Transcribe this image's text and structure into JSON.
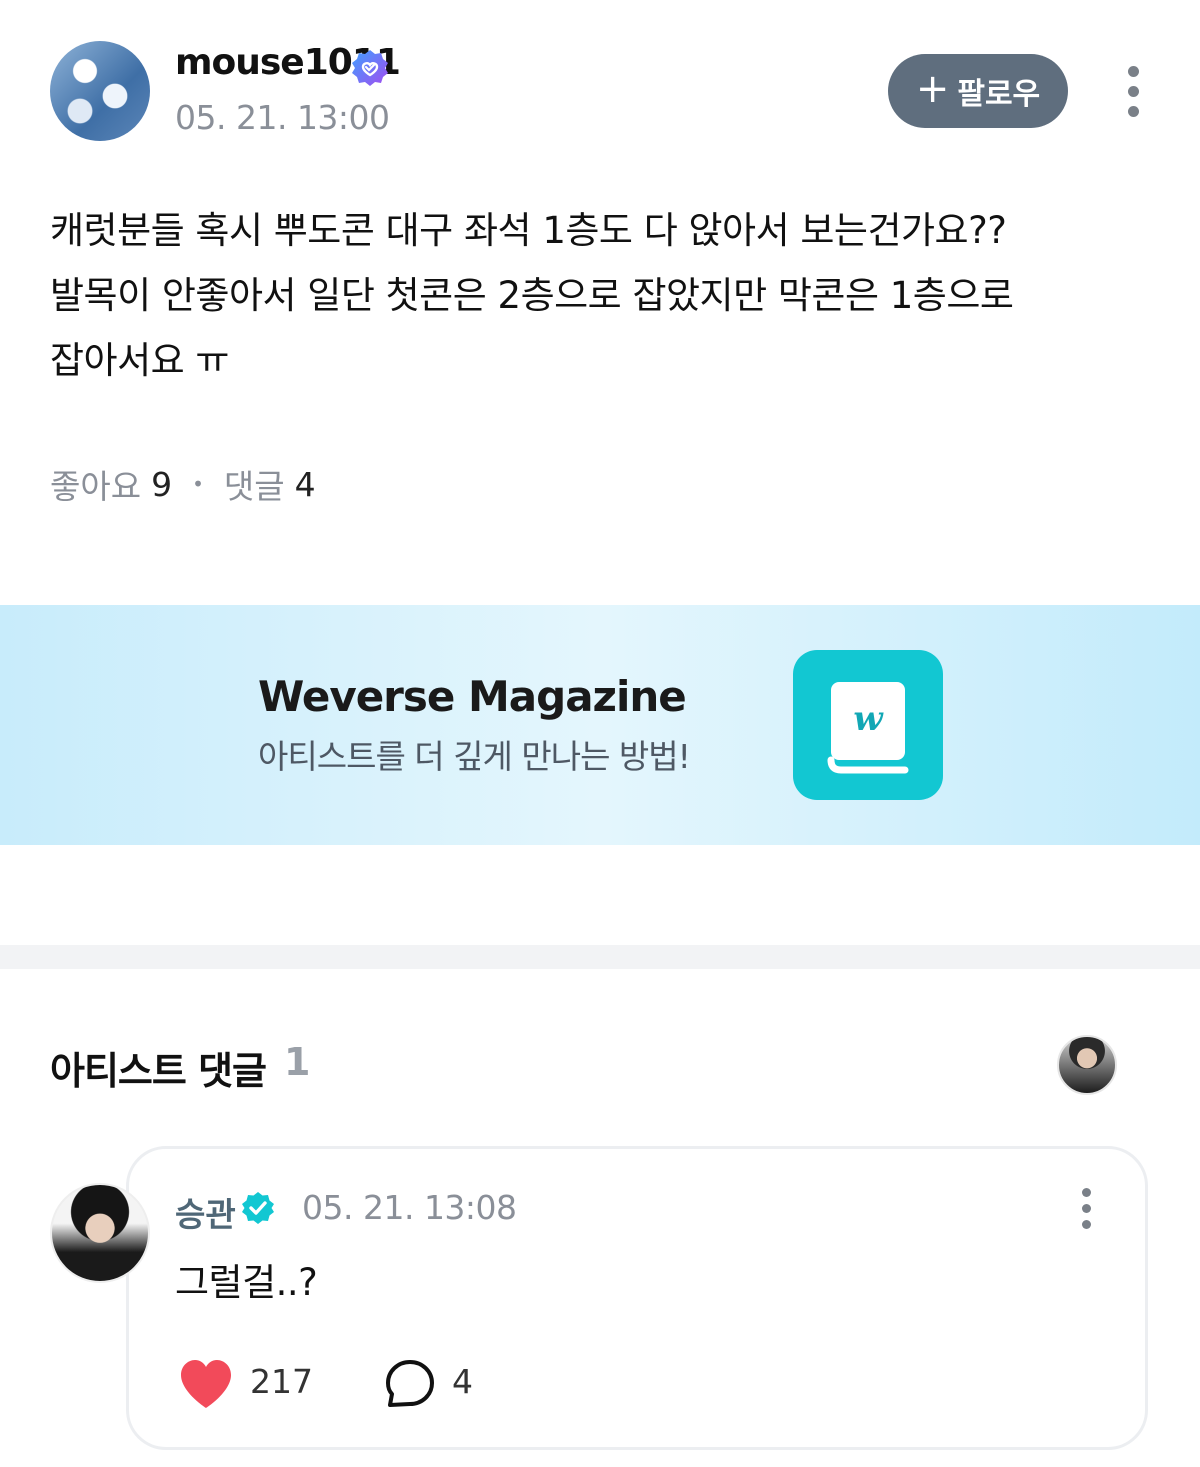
{
  "post": {
    "username": "mouse1011",
    "timestamp": "05. 21. 13:00",
    "follow_label": "팔로우",
    "body": "캐럿분들 혹시 뿌도콘 대구 좌석 1층도 다 앉아서 보는건가요??\n발목이 안좋아서 일단 첫콘은 2층으로 잡았지만 막콘은 1층으로\n잡아서요 ㅠ",
    "likes_label": "좋아요",
    "likes_count": "9",
    "comments_label": "댓글",
    "comments_count": "4"
  },
  "banner": {
    "title": "Weverse Magazine",
    "subtitle": "아티스트를 더 깊게 만나는 방법!",
    "icon_color": "#12c7d2"
  },
  "artist_comments": {
    "title": "아티스트 댓글",
    "count": "1",
    "comment": {
      "name": "승관",
      "timestamp": "05. 21. 13:08",
      "text": "그럴걸..?",
      "likes": "217",
      "replies": "4"
    }
  },
  "colors": {
    "follow_bg": "#5f6e7e",
    "verified_purple": "#7b5cf0",
    "verified_teal": "#12c7d2",
    "heart": "#f24a5a"
  }
}
